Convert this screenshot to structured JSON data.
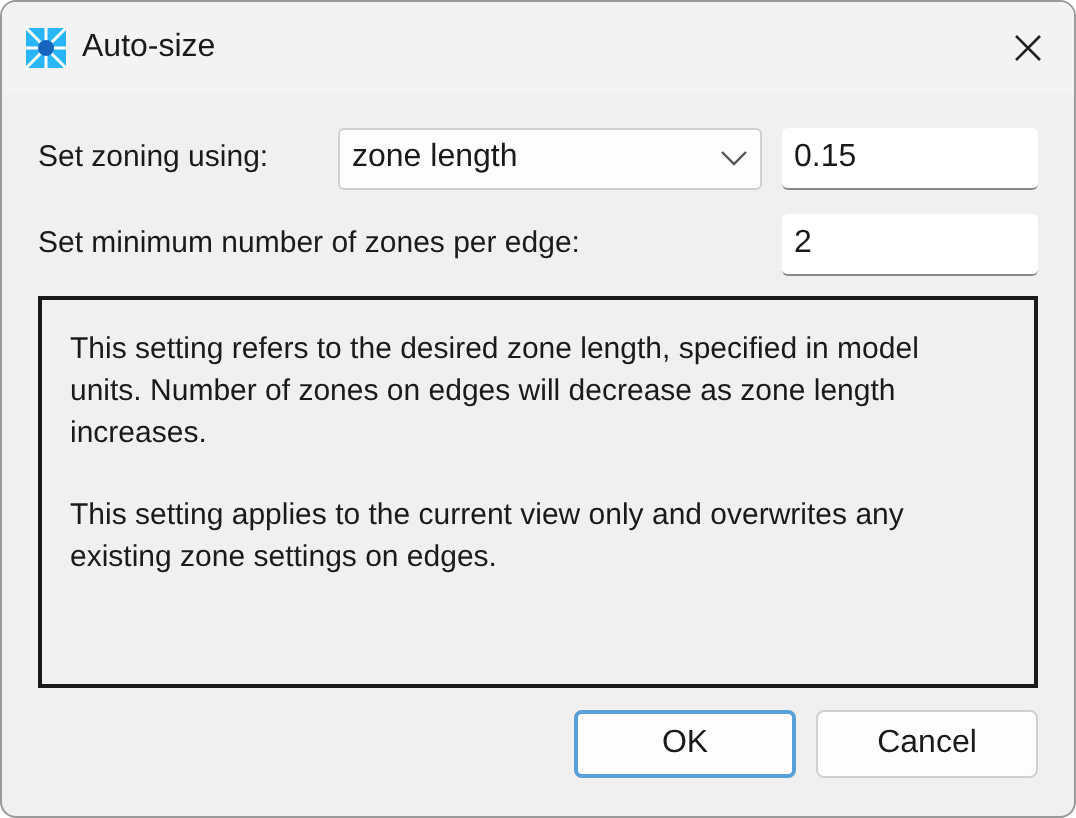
{
  "window": {
    "title": "Auto-size"
  },
  "zoning": {
    "label": "Set zoning using:",
    "value": "zone length",
    "amount": "0.15"
  },
  "minimum": {
    "label": "Set minimum number of zones per edge:",
    "value": "2"
  },
  "info": [
    "This setting refers to the desired zone length, specified in model units. Number of zones on edges will decrease as zone length increases.",
    "This setting applies to the current view only and overwrites any existing zone settings on edges."
  ],
  "buttons": [
    {
      "label": "OK",
      "default": true
    },
    {
      "label": "Cancel",
      "default": false
    }
  ]
}
